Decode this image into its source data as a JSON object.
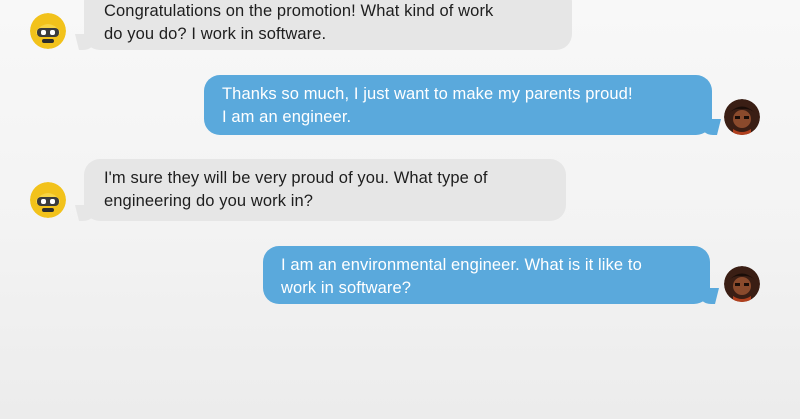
{
  "colors": {
    "background": "#f4f4f4",
    "incoming_bubble": "#e6e6e6",
    "incoming_text": "#1e1e1e",
    "outgoing_bubble": "#5aa9dc",
    "outgoing_text": "#ffffff",
    "bot_avatar": "#f2c21b",
    "user_avatar": "#3a1e14"
  },
  "messages": [
    {
      "sender": "bot",
      "avatar_icon": "bot-avatar-icon",
      "lines": [
        "Congratulations on the promotion! What kind of work",
        "do you do? I work in software."
      ]
    },
    {
      "sender": "user",
      "avatar_icon": "user-avatar-icon",
      "lines": [
        "Thanks so much, I just want to make my parents proud!",
        "I am an engineer."
      ]
    },
    {
      "sender": "bot",
      "avatar_icon": "bot-avatar-icon",
      "lines": [
        "I'm sure they will be very proud of you. What type of",
        "engineering do you work in?"
      ]
    },
    {
      "sender": "user",
      "avatar_icon": "user-avatar-icon",
      "lines": [
        "I am an environmental engineer. What is it like to",
        "work in software?"
      ]
    }
  ]
}
